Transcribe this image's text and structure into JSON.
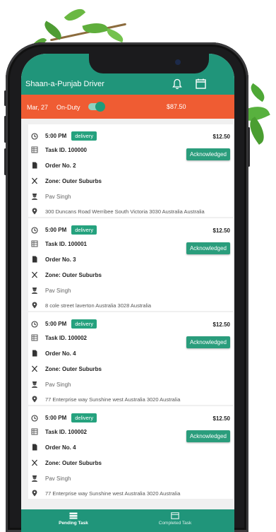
{
  "app": {
    "title": "Shaan-a-Punjab Driver"
  },
  "status": {
    "date": "Mar, 27",
    "duty": "On-Duty",
    "duty_on": true,
    "amount": "$87.50"
  },
  "tasks": [
    {
      "time": "5:00 PM",
      "type": "delivery",
      "amount": "$12.50",
      "task_id": "Task ID. 100000",
      "order": "Order No. 2",
      "zone": "Zone: Outer Suburbs",
      "driver": "Pav Singh",
      "address": "300 Duncans Road Werribee South Victoria 3030 Australia Australia",
      "action": "Acknowledged"
    },
    {
      "time": "5:00 PM",
      "type": "delivery",
      "amount": "$12.50",
      "task_id": "Task ID. 100001",
      "order": "Order No. 3",
      "zone": "Zone: Outer Suburbs",
      "driver": "Pav Singh",
      "address": "8 cole street laverton Australia 3028 Australia",
      "action": "Acknowledged"
    },
    {
      "time": "5:00 PM",
      "type": "delivery",
      "amount": "$12.50",
      "task_id": "Task ID. 100002",
      "order": "Order No. 4",
      "zone": "Zone: Outer Suburbs",
      "driver": "Pav Singh",
      "address": "77 Enterprise way Sunshine west Australia 3020 Australia",
      "action": "Acknowledged"
    },
    {
      "time": "5:00 PM",
      "type": "delivery",
      "amount": "$12.50",
      "task_id": "Task ID. 100002",
      "order": "Order No. 4",
      "zone": "Zone: Outer Suburbs",
      "driver": "Pav Singh",
      "address": "77 Enterprise way Sunshine west Australia 3020 Australia",
      "action": "Acknowledged"
    }
  ],
  "nav": {
    "pending": "Pending Task",
    "completed": "Completed Task"
  },
  "icons": {
    "header": [
      "bell-icon",
      "calendar-icon"
    ],
    "task_rows": [
      "clock-icon",
      "task-id-icon",
      "document-icon",
      "utensils-icon",
      "driver-icon",
      "location-pin-icon"
    ],
    "nav": [
      "pending-task-icon",
      "completed-task-icon"
    ]
  },
  "colors": {
    "primary": "#20957a",
    "status_bar": "#ef5c33",
    "button": "#2a9d7c"
  }
}
